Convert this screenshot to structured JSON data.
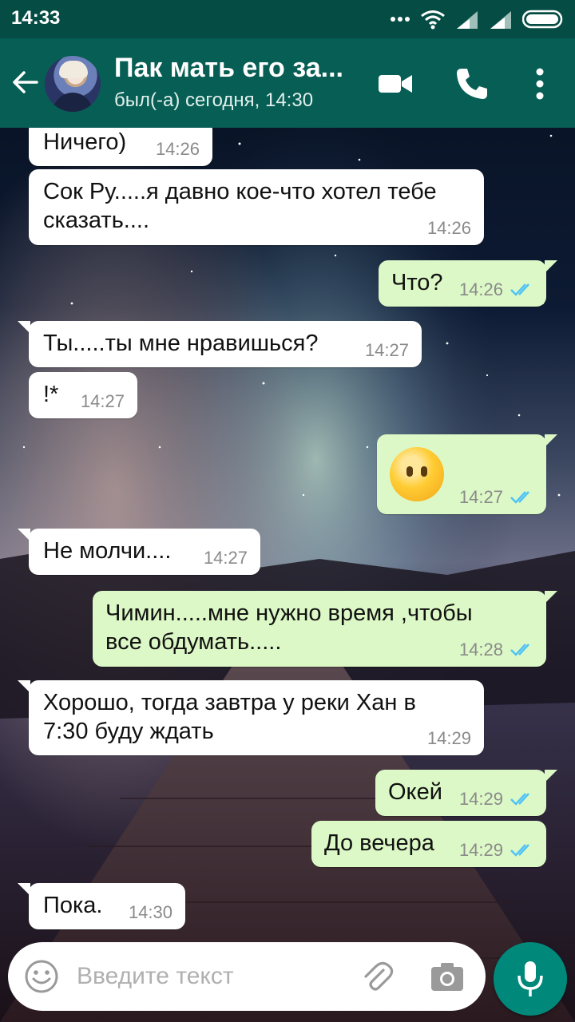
{
  "status_bar": {
    "time": "14:33"
  },
  "header": {
    "contact_name": "Пак мать его за...",
    "contact_status": "был(-а) сегодня, 14:30"
  },
  "messages": [
    {
      "direction": "in",
      "text": "Ничего)",
      "time": "14:26"
    },
    {
      "direction": "in",
      "text_lines": [
        "Сок Ру.....я давно кое-что хотел тебе",
        "сказать...."
      ],
      "time": "14:26"
    },
    {
      "direction": "out",
      "text": "Что?",
      "time": "14:26",
      "read": true
    },
    {
      "direction": "in",
      "text": "Ты.....ты мне нравишься?",
      "time": "14:27"
    },
    {
      "direction": "in",
      "text": "!*",
      "time": "14:27"
    },
    {
      "direction": "out",
      "emoji": "face-without-mouth",
      "time": "14:27",
      "read": true
    },
    {
      "direction": "in",
      "text": "Не молчи....",
      "time": "14:27"
    },
    {
      "direction": "out",
      "text_lines": [
        "Чимин.....мне нужно время ,чтобы",
        "все  обдумать....."
      ],
      "time": "14:28",
      "read": true
    },
    {
      "direction": "in",
      "text_lines": [
        "Хорошо, тогда завтра у реки Хан в",
        "7:30 буду ждать"
      ],
      "time": "14:29"
    },
    {
      "direction": "out",
      "text": "Окей",
      "time": "14:29",
      "read": true
    },
    {
      "direction": "out",
      "text": "До вечера",
      "time": "14:29",
      "read": true
    },
    {
      "direction": "in",
      "text": "Пока.",
      "time": "14:30"
    }
  ],
  "input": {
    "placeholder": "Введите текст"
  },
  "colors": {
    "header": "#075e54",
    "status_bar": "#054d44",
    "outgoing_bubble": "#dcf8c6",
    "incoming_bubble": "#ffffff",
    "read_tick": "#4fc3f7",
    "mic_button": "#00897b"
  },
  "icons": [
    "back-arrow-icon",
    "video-call-icon",
    "phone-icon",
    "more-vert-icon",
    "emoji-icon",
    "attach-icon",
    "camera-icon",
    "mic-icon",
    "wifi-icon",
    "signal-icon",
    "battery-icon",
    "double-check-icon"
  ]
}
